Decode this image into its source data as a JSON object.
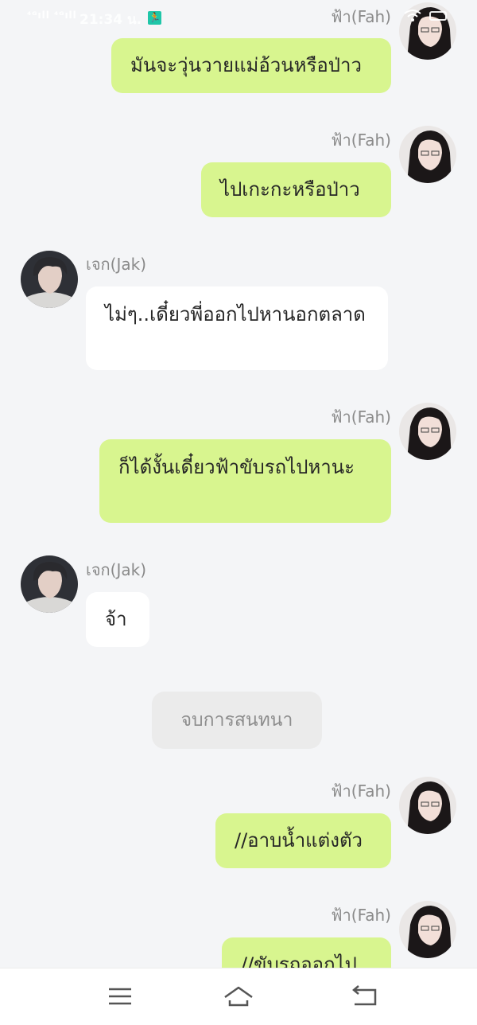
{
  "status_bar": {
    "signal": "⁴ᴳıll ⁴ᴳıll",
    "time": "21:34 น."
  },
  "chat": {
    "messages": [
      {
        "side": "right",
        "sender": "ฟ้า(Fah)",
        "text": "มันจะวุ่นวายแม่อ้วนหรือป่าว"
      },
      {
        "side": "right",
        "sender": "ฟ้า(Fah)",
        "text": "ไปเกะกะหรือป่าว"
      },
      {
        "side": "left",
        "sender": "เจก(Jak)",
        "text": "ไม่ๆ..เดี๋ยวพี่ออกไปหานอกตลาด"
      },
      {
        "side": "right",
        "sender": "ฟ้า(Fah)",
        "text": "ก็ได้งั้นเดี๋ยวฟ้าขับรถไปหานะ"
      },
      {
        "side": "left",
        "sender": "เจก(Jak)",
        "text": "จ้า"
      },
      {
        "side": "right",
        "sender": "ฟ้า(Fah)",
        "text": "//อาบน้ำแต่งตัว"
      },
      {
        "side": "right",
        "sender": "ฟ้า(Fah)",
        "text": "//ขับรถออกไป"
      }
    ],
    "system_note": "จบการสนทนา"
  },
  "nav": {
    "icons": [
      "menu-icon",
      "home-icon",
      "back-icon"
    ]
  },
  "colors": {
    "outgoing_bubble": "#d8f58f",
    "incoming_bubble": "#ffffff",
    "background": "#f4f5f7",
    "system_note_bg": "#ebebeb"
  }
}
